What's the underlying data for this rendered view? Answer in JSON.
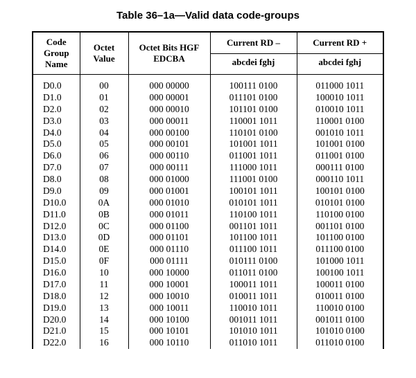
{
  "caption": "Table 36–1a—Valid data code-groups",
  "headers": {
    "codeGroupName": "Code Group Name",
    "octetValue": "Octet Value",
    "octetBits": "Octet Bits HGF EDCBA",
    "rdMinus": "Current RD –",
    "rdPlus": "Current RD +",
    "sub": "abcdei fghj"
  },
  "rows": [
    {
      "name": "D0.0",
      "oct": "00",
      "bits": "000 00000",
      "rdm": "100111 0100",
      "rdp": "011000 1011"
    },
    {
      "name": "D1.0",
      "oct": "01",
      "bits": "000 00001",
      "rdm": "011101 0100",
      "rdp": "100010 1011"
    },
    {
      "name": "D2.0",
      "oct": "02",
      "bits": "000 00010",
      "rdm": "101101 0100",
      "rdp": "010010 1011"
    },
    {
      "name": "D3.0",
      "oct": "03",
      "bits": "000 00011",
      "rdm": "110001 1011",
      "rdp": "110001 0100"
    },
    {
      "name": "D4.0",
      "oct": "04",
      "bits": "000 00100",
      "rdm": "110101 0100",
      "rdp": "001010 1011"
    },
    {
      "name": "D5.0",
      "oct": "05",
      "bits": "000 00101",
      "rdm": "101001 1011",
      "rdp": "101001 0100"
    },
    {
      "name": "D6.0",
      "oct": "06",
      "bits": "000 00110",
      "rdm": "011001 1011",
      "rdp": "011001 0100"
    },
    {
      "name": "D7.0",
      "oct": "07",
      "bits": "000 00111",
      "rdm": "111000 1011",
      "rdp": "000111 0100"
    },
    {
      "name": "D8.0",
      "oct": "08",
      "bits": "000 01000",
      "rdm": "111001 0100",
      "rdp": "000110 1011"
    },
    {
      "name": "D9.0",
      "oct": "09",
      "bits": "000 01001",
      "rdm": "100101 1011",
      "rdp": "100101 0100"
    },
    {
      "name": "D10.0",
      "oct": "0A",
      "bits": "000 01010",
      "rdm": "010101 1011",
      "rdp": "010101 0100"
    },
    {
      "name": "D11.0",
      "oct": "0B",
      "bits": "000 01011",
      "rdm": "110100 1011",
      "rdp": "110100 0100"
    },
    {
      "name": "D12.0",
      "oct": "0C",
      "bits": "000 01100",
      "rdm": "001101 1011",
      "rdp": "001101 0100"
    },
    {
      "name": "D13.0",
      "oct": "0D",
      "bits": "000 01101",
      "rdm": "101100 1011",
      "rdp": "101100 0100"
    },
    {
      "name": "D14.0",
      "oct": "0E",
      "bits": "000 01110",
      "rdm": "011100 1011",
      "rdp": "011100 0100"
    },
    {
      "name": "D15.0",
      "oct": "0F",
      "bits": "000 01111",
      "rdm": "010111 0100",
      "rdp": "101000 1011"
    },
    {
      "name": "D16.0",
      "oct": "10",
      "bits": "000 10000",
      "rdm": "011011 0100",
      "rdp": "100100 1011"
    },
    {
      "name": "D17.0",
      "oct": "11",
      "bits": "000 10001",
      "rdm": "100011 1011",
      "rdp": "100011 0100"
    },
    {
      "name": "D18.0",
      "oct": "12",
      "bits": "000 10010",
      "rdm": "010011 1011",
      "rdp": "010011 0100"
    },
    {
      "name": "D19.0",
      "oct": "13",
      "bits": "000 10011",
      "rdm": "110010 1011",
      "rdp": "110010 0100"
    },
    {
      "name": "D20.0",
      "oct": "14",
      "bits": "000 10100",
      "rdm": "001011 1011",
      "rdp": "001011 0100"
    },
    {
      "name": "D21.0",
      "oct": "15",
      "bits": "000 10101",
      "rdm": "101010 1011",
      "rdp": "101010 0100"
    },
    {
      "name": "D22.0",
      "oct": "16",
      "bits": "000 10110",
      "rdm": "011010 1011",
      "rdp": "011010 0100"
    }
  ]
}
